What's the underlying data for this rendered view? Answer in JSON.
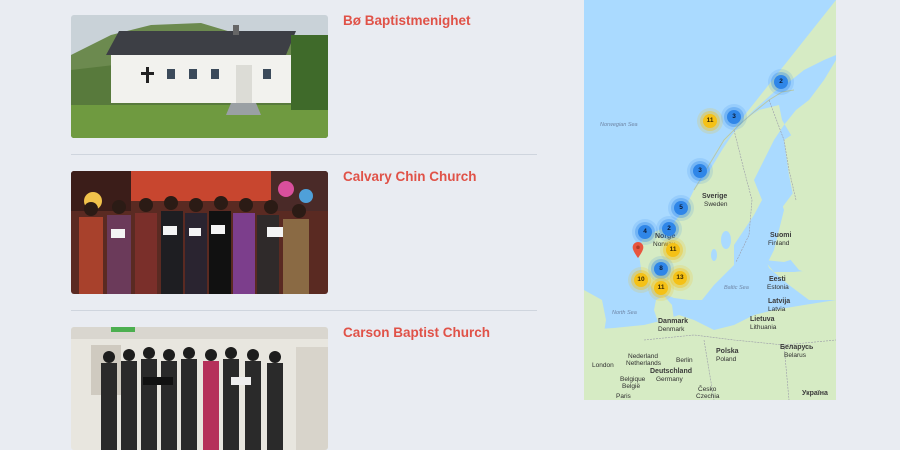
{
  "listings": [
    {
      "title": "Bø Baptistmenighet"
    },
    {
      "title": "Calvary Chin Church"
    },
    {
      "title": "Carson Baptist Church"
    }
  ],
  "map": {
    "seas": {
      "norwegian": "Norwegian Sea",
      "north": "North Sea",
      "baltic": "Baltic Sea"
    },
    "places": {
      "sverige": "Sverige",
      "sweden": "Sweden",
      "norge": "Norge",
      "norway": "Norway",
      "suomi": "Suomi",
      "finland": "Finland",
      "eesti": "Eesti",
      "estonia": "Estonia",
      "latvija": "Latvija",
      "latvia": "Latvia",
      "lietuva": "Lietuva",
      "lithuania": "Lithuania",
      "danmark": "Danmark",
      "denmark": "Denmark",
      "nederland": "Nederland",
      "netherlands": "Netherlands",
      "belgique": "Belgique",
      "belgie": "België",
      "berlin": "Berlin",
      "deutschland": "Deutschland",
      "germany": "Germany",
      "polska": "Polska",
      "poland": "Poland",
      "belarus_local": "Беларусь",
      "belarus": "Belarus",
      "ceska": "Česko",
      "czechia": "Czechia",
      "ukraine": "Україна",
      "london": "London",
      "paris": "Paris"
    },
    "clusters": [
      {
        "count": "2",
        "color": "blue"
      },
      {
        "count": "3",
        "color": "blue"
      },
      {
        "count": "11",
        "color": "yellow"
      },
      {
        "count": "3",
        "color": "blue"
      },
      {
        "count": "5",
        "color": "blue"
      },
      {
        "count": "4",
        "color": "blue"
      },
      {
        "count": "2",
        "color": "blue"
      },
      {
        "count": "11",
        "color": "yellow"
      },
      {
        "count": "8",
        "color": "blue"
      },
      {
        "count": "10",
        "color": "yellow"
      },
      {
        "count": "13",
        "color": "yellow"
      },
      {
        "count": "11",
        "color": "yellow"
      }
    ],
    "colors": {
      "water": "#aadaff",
      "land": "#d6ebc4",
      "cluster_blue": "#2f86e8",
      "cluster_yellow": "#f5c116",
      "pin": "#e8553f"
    }
  }
}
